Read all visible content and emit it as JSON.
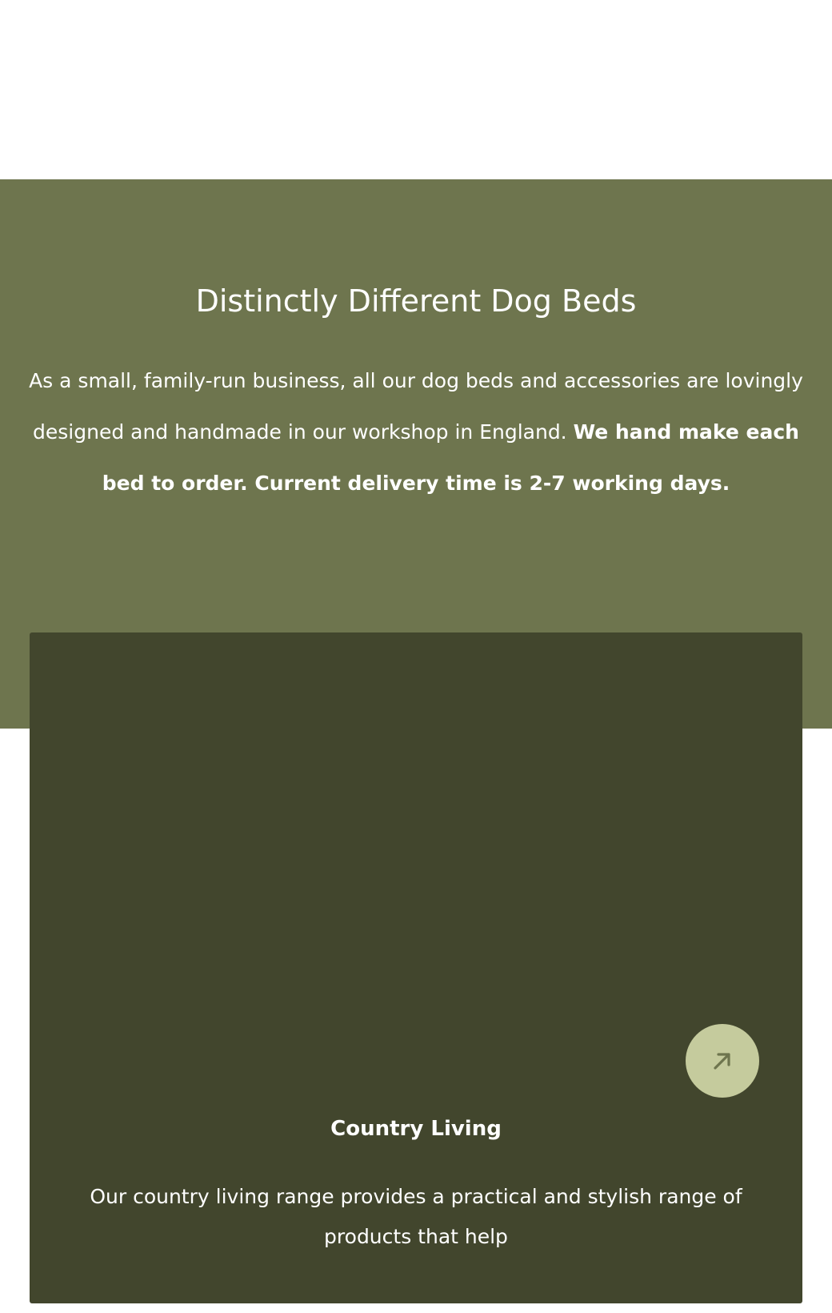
{
  "hero": {
    "title": "Distinctly Different Dog Beds",
    "text_regular": "As a small, family-run business, all our dog beds and accessories are lovingly designed and handmade in our workshop in England. ",
    "text_bold": "We hand make each bed to order. Current delivery time is 2-7 working days."
  },
  "card": {
    "title": "Country Living",
    "description": "Our country living range provides a practical and stylish range of products that help",
    "button_icon": "arrow-up-right-icon"
  },
  "colors": {
    "hero_background": "#6e754e",
    "card_background": "#42462d",
    "button_background": "#c5cb9d",
    "button_icon": "#6e754e",
    "text": "#ffffff"
  }
}
